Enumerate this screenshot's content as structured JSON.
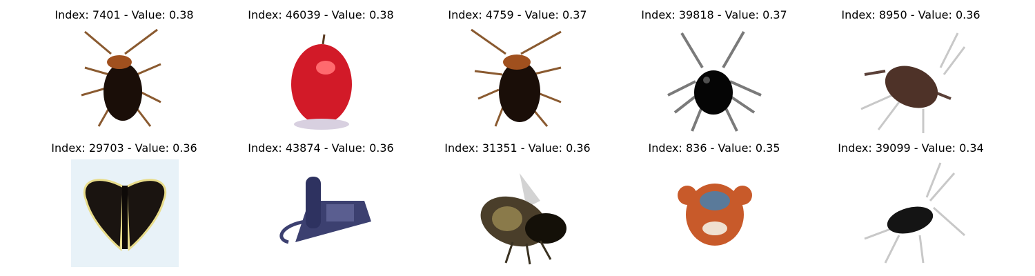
{
  "grid": {
    "panels": [
      {
        "index": "7401",
        "value": "0.38",
        "title": "Index: 7401 - Value: 0.38",
        "subject": "cockroach-image",
        "color": "#7a3a14"
      },
      {
        "index": "46039",
        "value": "0.38",
        "title": "Index: 46039 - Value: 0.38",
        "subject": "apple-image",
        "color": "#d8202c"
      },
      {
        "index": "4759",
        "value": "0.37",
        "title": "Index: 4759 - Value: 0.37",
        "subject": "cockroach-image",
        "color": "#7a3a14"
      },
      {
        "index": "39818",
        "value": "0.37",
        "title": "Index: 39818 - Value: 0.37",
        "subject": "spider-image",
        "color": "#0a0a0a"
      },
      {
        "index": "8950",
        "value": "0.36",
        "title": "Index: 8950 - Value: 0.36",
        "subject": "cockroach-image",
        "color": "#5a3a2c"
      },
      {
        "index": "29703",
        "value": "0.36",
        "title": "Index: 29703 - Value: 0.36",
        "subject": "butterfly-image",
        "color": "#1a1412"
      },
      {
        "index": "43874",
        "value": "0.36",
        "title": "Index: 43874 - Value: 0.36",
        "subject": "telephone-image",
        "color": "#3c4070"
      },
      {
        "index": "31351",
        "value": "0.36",
        "title": "Index: 31351 - Value: 0.36",
        "subject": "bee-image",
        "color": "#3a3222"
      },
      {
        "index": "836",
        "value": "0.35",
        "title": "Index: 836 - Value: 0.35",
        "subject": "crab-image",
        "color": "#c85a2a"
      },
      {
        "index": "39099",
        "value": "0.34",
        "title": "Index: 39099 - Value: 0.34",
        "subject": "cockroach-image",
        "color": "#1e1e1e"
      }
    ]
  }
}
